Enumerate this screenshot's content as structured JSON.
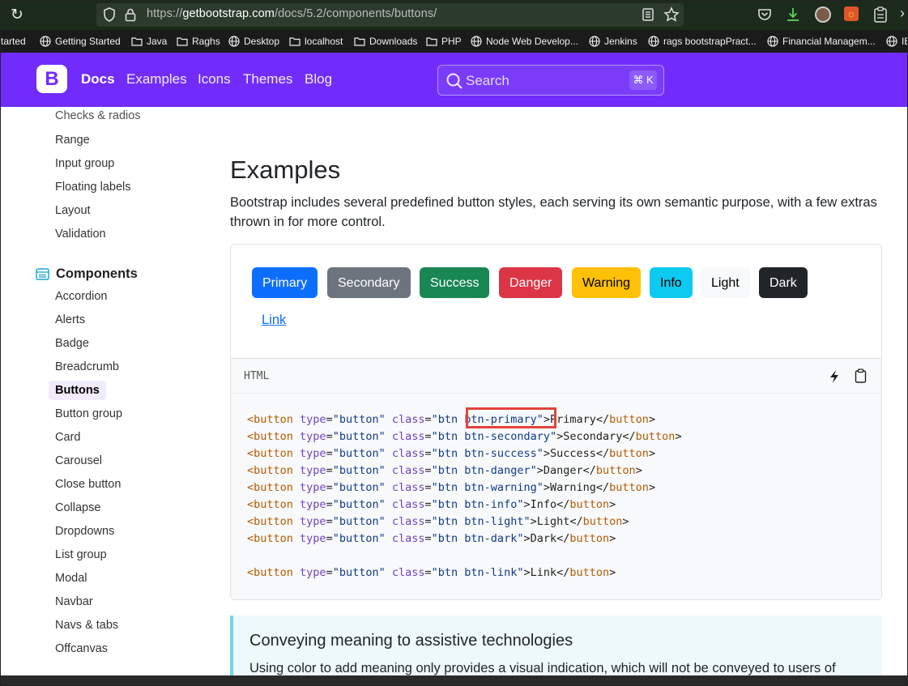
{
  "browser": {
    "url_prefix": "https://",
    "url_domain": "getbootstrap.com",
    "url_path": "/docs/5.2/components/buttons/",
    "toolbar_icons": [
      "reload-icon",
      "shield-icon",
      "lock-icon",
      "reader-view-icon",
      "bookmark-star-icon",
      "pocket-icon",
      "download-icon",
      "profile-avatar",
      "extension-icon",
      "clipboard-extension-icon",
      "more-icon"
    ]
  },
  "bookmarks": [
    {
      "label": "tarted",
      "icon": "none"
    },
    {
      "label": "Getting Started",
      "icon": "globe"
    },
    {
      "label": "Java",
      "icon": "folder"
    },
    {
      "label": "Raghs",
      "icon": "folder"
    },
    {
      "label": "Desktop",
      "icon": "globe"
    },
    {
      "label": "localhost",
      "icon": "folder"
    },
    {
      "label": "Downloads",
      "icon": "folder"
    },
    {
      "label": "PHP",
      "icon": "folder"
    },
    {
      "label": "Node Web Develop...",
      "icon": "globe"
    },
    {
      "label": "Jenkins",
      "icon": "globe"
    },
    {
      "label": "rags bootstrapPract...",
      "icon": "globe"
    },
    {
      "label": "Financial Managem...",
      "icon": "globe"
    },
    {
      "label": "IE",
      "icon": "globe"
    }
  ],
  "navbar": {
    "brand": "B",
    "links": [
      "Docs",
      "Examples",
      "Icons",
      "Themes",
      "Blog"
    ],
    "search_placeholder": "Search",
    "search_shortcut": "⌘ K"
  },
  "sidebar": {
    "forms_items": [
      "Checks & radios",
      "Range",
      "Input group",
      "Floating labels",
      "Layout",
      "Validation"
    ],
    "components_title": "Components",
    "components_items": [
      "Accordion",
      "Alerts",
      "Badge",
      "Breadcrumb",
      "Buttons",
      "Button group",
      "Card",
      "Carousel",
      "Close button",
      "Collapse",
      "Dropdowns",
      "List group",
      "Modal",
      "Navbar",
      "Navs & tabs",
      "Offcanvas"
    ],
    "active_item": "Buttons"
  },
  "main": {
    "title": "Examples",
    "lead": "Bootstrap includes several predefined button styles, each serving its own semantic purpose, with a few extras thrown in for more control.",
    "buttons": [
      {
        "label": "Primary",
        "bg": "#0d6efd",
        "color": "#ffffff"
      },
      {
        "label": "Secondary",
        "bg": "#6c757d",
        "color": "#ffffff"
      },
      {
        "label": "Success",
        "bg": "#198754",
        "color": "#ffffff"
      },
      {
        "label": "Danger",
        "bg": "#dc3545",
        "color": "#ffffff"
      },
      {
        "label": "Warning",
        "bg": "#ffc107",
        "color": "#000000"
      },
      {
        "label": "Info",
        "bg": "#0dcaf0",
        "color": "#000000"
      },
      {
        "label": "Light",
        "bg": "#f8f9fa",
        "color": "#000000"
      },
      {
        "label": "Dark",
        "bg": "#212529",
        "color": "#ffffff"
      }
    ],
    "link_button": "Link",
    "code_label": "HTML",
    "code_lines": [
      {
        "cls": "btn-primary",
        "text": "Primary"
      },
      {
        "cls": "btn-secondary",
        "text": "Secondary"
      },
      {
        "cls": "btn-success",
        "text": "Success"
      },
      {
        "cls": "btn-danger",
        "text": "Danger"
      },
      {
        "cls": "btn-warning",
        "text": "Warning"
      },
      {
        "cls": "btn-info",
        "text": "Info"
      },
      {
        "cls": "btn-light",
        "text": "Light"
      },
      {
        "cls": "btn-dark",
        "text": "Dark"
      },
      {
        "cls": "btn-link",
        "text": "Link"
      }
    ],
    "highlighted_token": "btn-primary\"",
    "callout_title": "Conveying meaning to assistive technologies",
    "callout_text": "Using color to add meaning only provides a visual indication, which will not be conveyed to users of"
  },
  "colors": {
    "brand": "#712cf9",
    "highlight_box": "#e0443a",
    "callout_border": "#6fd5ea"
  }
}
